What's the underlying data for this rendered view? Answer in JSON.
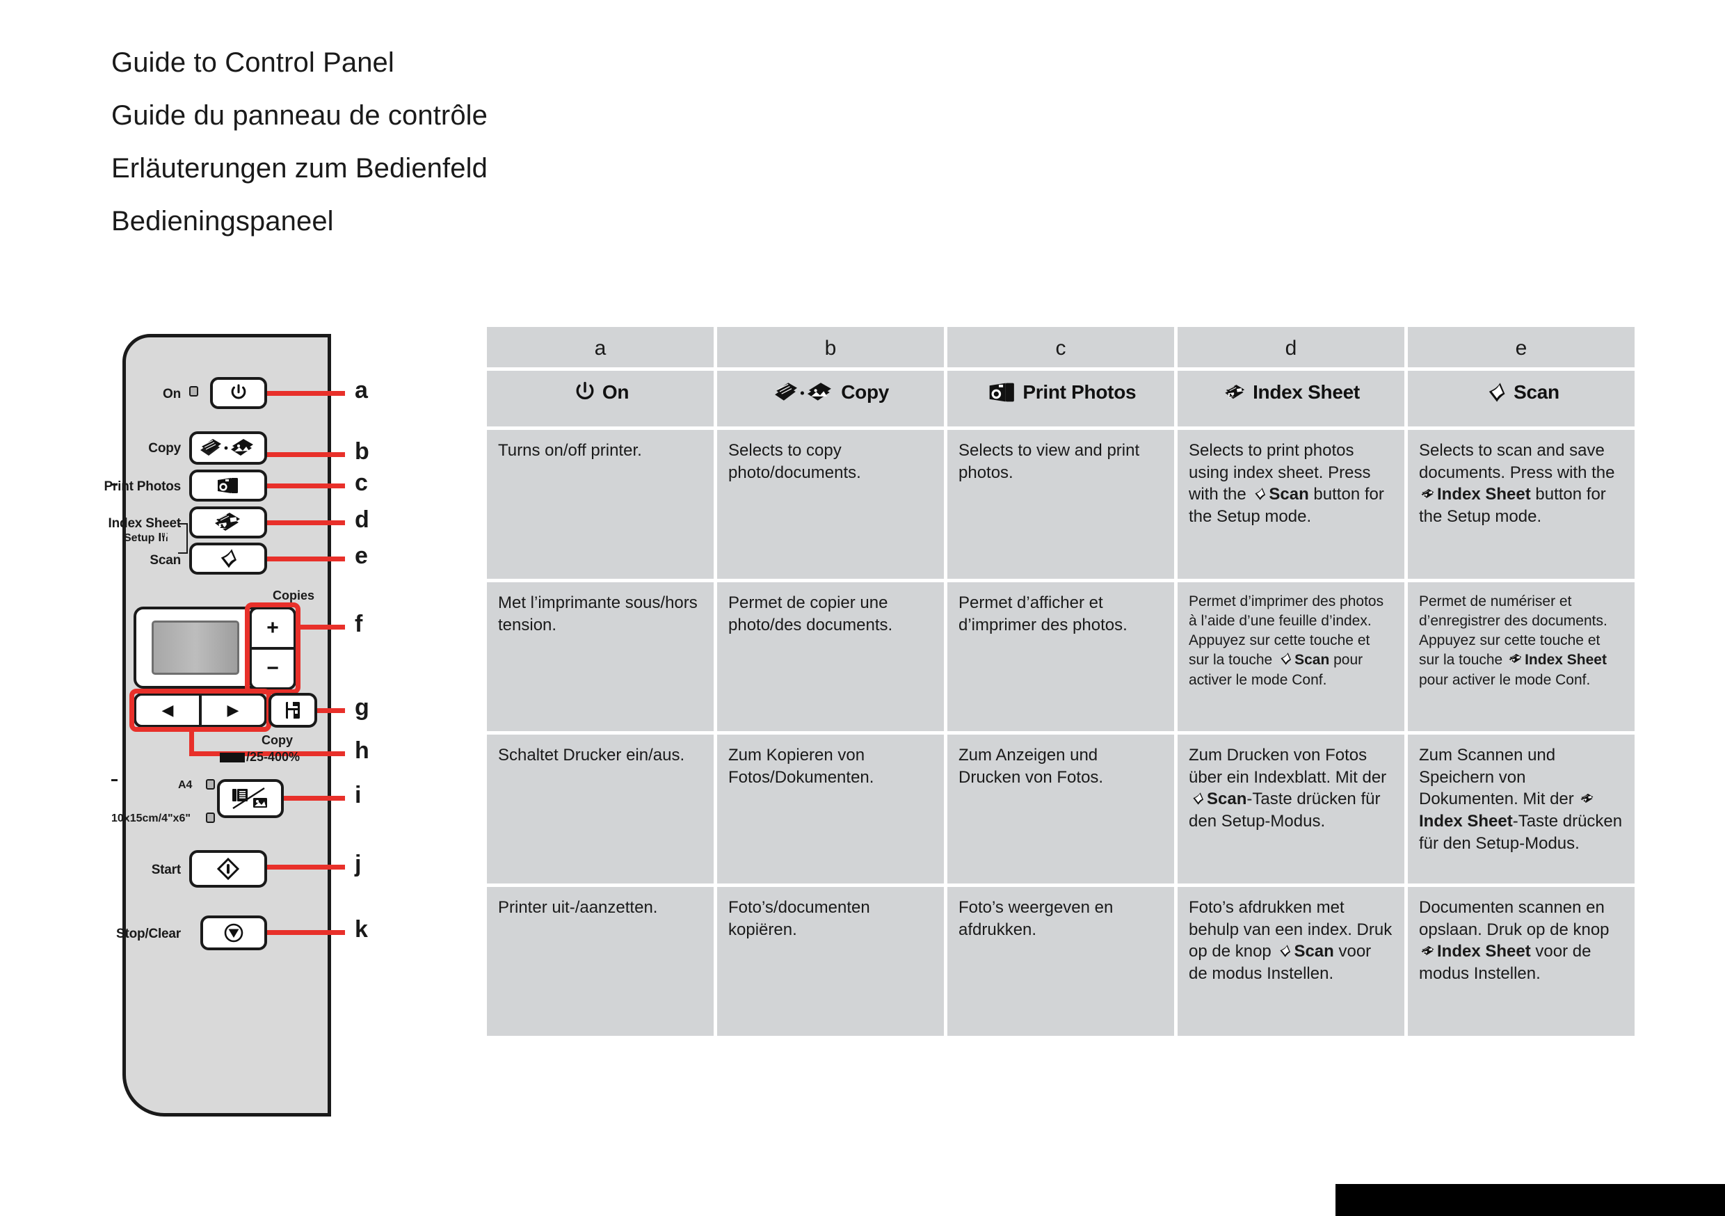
{
  "titles": [
    "Guide to Control Panel",
    "Guide du panneau de contrôle",
    "Erläuterungen zum Bedienfeld",
    "Bedieningspaneel"
  ],
  "panel": {
    "labels": {
      "on": "On",
      "copy": "Copy",
      "print_photos": "Print Photos",
      "index_sheet": "Index Sheet",
      "setup": "Setup",
      "scan": "Scan",
      "copies": "Copies",
      "copy_zoom_title": "Copy",
      "copy_zoom_range": "/25-400%",
      "paper_a4": "A4",
      "paper_10x15": "10x15cm/4\"x6\"",
      "start": "Start",
      "stop_clear": "Stop/Clear"
    },
    "callouts": [
      "a",
      "b",
      "c",
      "d",
      "e",
      "f",
      "g",
      "h",
      "i",
      "j",
      "k"
    ],
    "icons": {
      "power": "power-icon",
      "copy": "copy-icon",
      "print_photos": "print-photos-icon",
      "index_sheet": "index-sheet-icon",
      "scan": "scan-icon",
      "plus": "+",
      "minus": "−",
      "left": "◀",
      "right": "▶",
      "paper_setting": "paper-setting-icon",
      "doc_photo": "document-photo-icon",
      "start": "start-diamond-icon",
      "stop": "stop-icon",
      "setup_wrench": "setup-tools-icon"
    }
  },
  "table": {
    "header_letters": [
      "a",
      "b",
      "c",
      "d",
      "e"
    ],
    "header_buttons": [
      {
        "icon": "power-icon",
        "label": "On"
      },
      {
        "icon": "copy-icon",
        "label": "Copy"
      },
      {
        "icon": "print-photos-icon",
        "label": "Print Photos"
      },
      {
        "icon": "index-sheet-icon",
        "label": "Index Sheet"
      },
      {
        "icon": "scan-icon",
        "label": "Scan"
      }
    ],
    "rows": [
      {
        "lang": "en",
        "cells": [
          {
            "text": "Turns on/off printer."
          },
          {
            "text": "Selects to copy photo/documents."
          },
          {
            "text": "Selects to view and print photos."
          },
          {
            "pre": "Selects to print photos using index sheet. Press with the ",
            "icon": "scan-icon",
            "bold": "Scan",
            "post": " button for the Setup mode."
          },
          {
            "pre": "Selects to scan and save documents. Press with the ",
            "icon": "index-sheet-icon",
            "bold": "Index Sheet",
            "post": " button for the Setup mode."
          }
        ]
      },
      {
        "lang": "fr",
        "cells": [
          {
            "text": "Met l’imprimante sous/hors tension."
          },
          {
            "text": "Permet de copier une photo/des documents."
          },
          {
            "text": "Permet d’afficher et d’imprimer des photos."
          },
          {
            "pre": "Permet d’imprimer des photos à l’aide d’une feuille d’index. Appuyez sur cette touche et sur la touche ",
            "icon": "scan-icon",
            "bold": "Scan",
            "post": " pour activer le mode Conf."
          },
          {
            "pre": "Permet de numériser et d’enregistrer des documents. Appuyez sur cette touche et sur la touche ",
            "icon": "index-sheet-icon",
            "bold": "Index Sheet",
            "post": " pour activer le mode Conf."
          }
        ]
      },
      {
        "lang": "de",
        "cells": [
          {
            "text": "Schaltet Drucker ein/aus."
          },
          {
            "text": "Zum Kopieren von Fotos/Dokumenten."
          },
          {
            "text": "Zum Anzeigen und Drucken von Fotos."
          },
          {
            "pre": "Zum Drucken von Fotos über ein Indexblatt. Mit der ",
            "icon": "scan-icon",
            "bold": "Scan",
            "post": "-Taste drücken für den Setup-Modus."
          },
          {
            "pre": "Zum Scannen und Speichern von Dokumenten. Mit der ",
            "icon": "index-sheet-icon",
            "bold": "Index Sheet",
            "post": "-Taste drücken für den Setup-Modus."
          }
        ]
      },
      {
        "lang": "nl",
        "cells": [
          {
            "text": "Printer uit-/aanzetten."
          },
          {
            "text": "Foto’s/documenten kopiëren."
          },
          {
            "text": "Foto’s weergeven en afdrukken."
          },
          {
            "pre": "Foto’s afdrukken met behulp van een index. Druk op de knop ",
            "icon": "scan-icon",
            "bold": "Scan",
            "post": " voor de modus Instellen."
          },
          {
            "pre": "Documenten scannen en opslaan. Druk op de knop ",
            "icon": "index-sheet-icon",
            "bold": "Index Sheet",
            "post": " voor de modus Instellen."
          }
        ]
      }
    ]
  },
  "colors": {
    "callout_red": "#e8302a",
    "table_cell": "#d2d4d6",
    "panel_body": "#d9d9d9",
    "ink": "#1a1a1a"
  }
}
